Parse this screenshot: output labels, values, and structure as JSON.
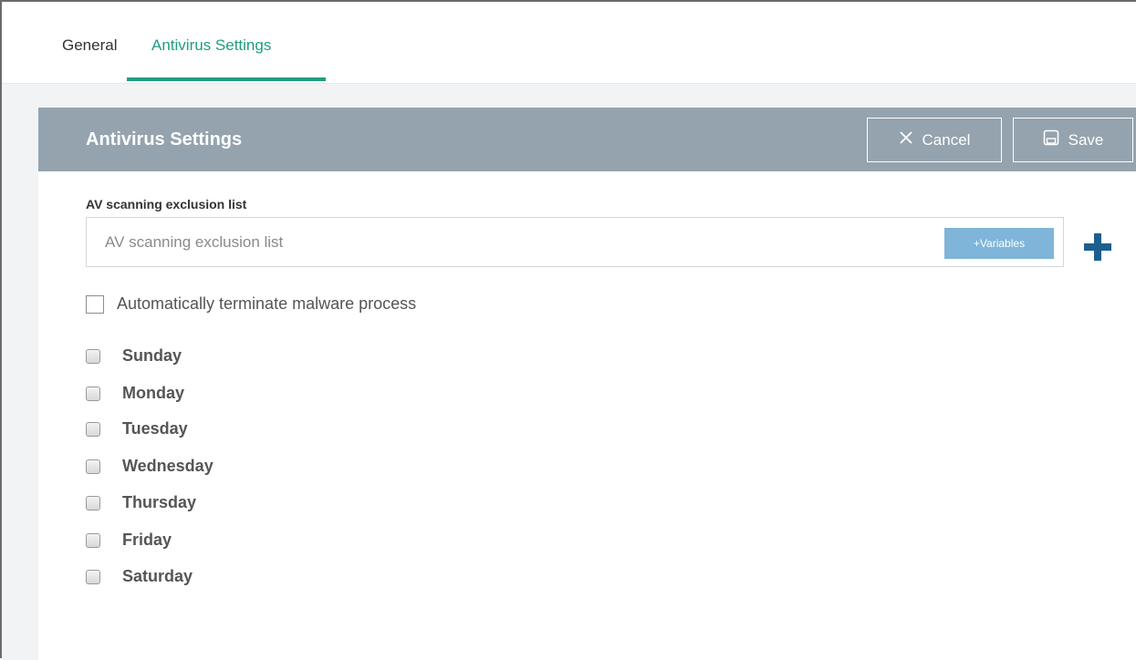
{
  "tabs": [
    {
      "label": "General",
      "active": false
    },
    {
      "label": "Antivirus Settings",
      "active": true
    }
  ],
  "panel": {
    "title": "Antivirus Settings",
    "cancel_label": "Cancel",
    "save_label": "Save"
  },
  "exclusion": {
    "label": "AV scanning exclusion list",
    "placeholder": "AV scanning exclusion list",
    "value": "",
    "variables_label": "+Variables"
  },
  "auto_terminate": {
    "label": "Automatically terminate malware process",
    "checked": false
  },
  "days": [
    {
      "label": "Sunday",
      "checked": false
    },
    {
      "label": "Monday",
      "checked": false
    },
    {
      "label": "Tuesday",
      "checked": false
    },
    {
      "label": "Wednesday",
      "checked": false
    },
    {
      "label": "Thursday",
      "checked": false
    },
    {
      "label": "Friday",
      "checked": false
    },
    {
      "label": "Saturday",
      "checked": false
    }
  ],
  "colors": {
    "accent": "#1f9d7f",
    "header_bg": "#94a3ae",
    "variables_bg": "#7fb5d9",
    "plus": "#1c5f8f"
  },
  "icons": {
    "cancel": "close-icon",
    "save": "save-disk-icon",
    "add": "plus-icon"
  }
}
